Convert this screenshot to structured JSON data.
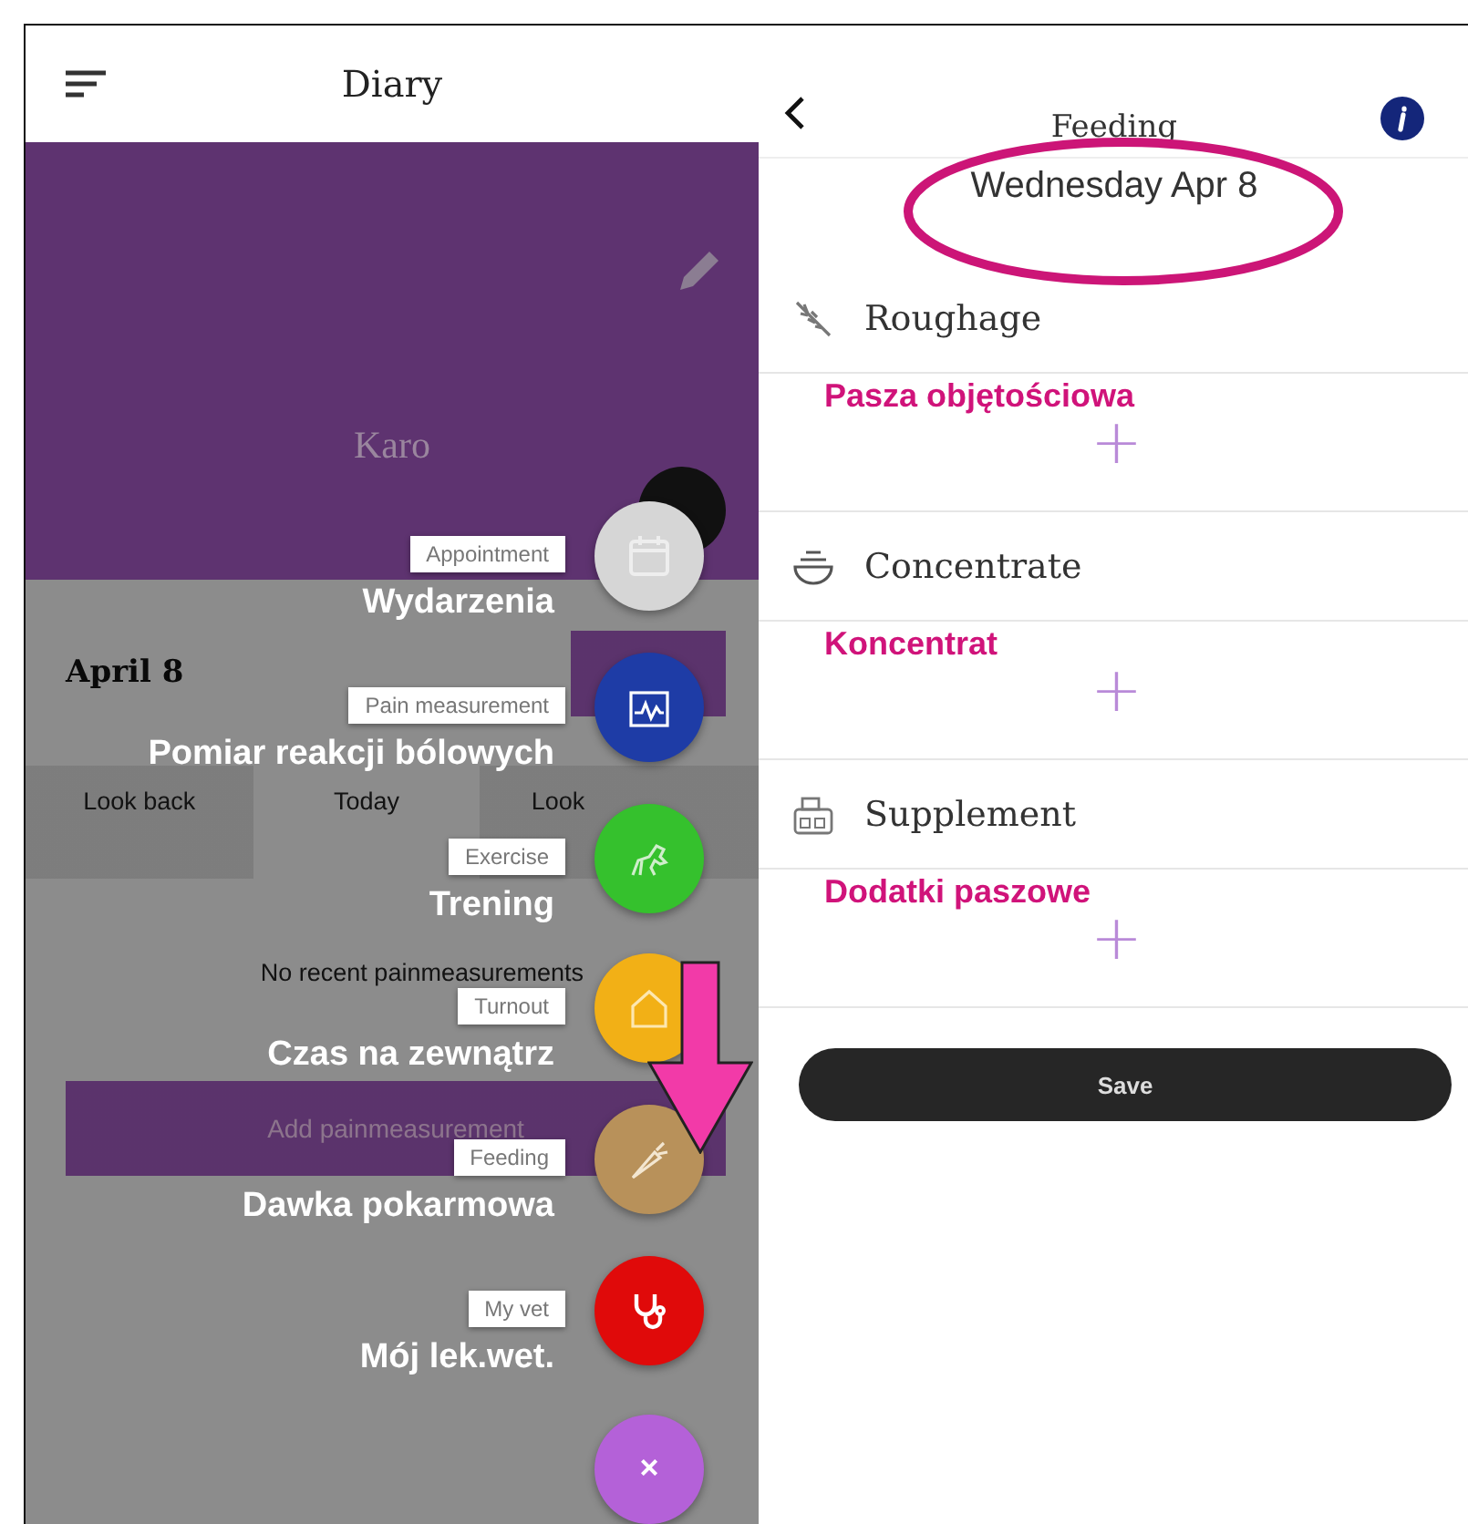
{
  "left_screen": {
    "header": {
      "title": "Diary"
    },
    "banner": {
      "name": "Karo"
    },
    "date": "April 8",
    "tabs": [
      {
        "label": "Look back",
        "selected": false
      },
      {
        "label": "Today",
        "selected": true
      },
      {
        "label": "Look",
        "selected": false
      }
    ],
    "empty_message": "No recent painmeasurements",
    "add_button": "Add painmeasurement",
    "fab_menu": {
      "items": [
        {
          "kind": "calendar",
          "label": "Appointment",
          "annotation": "Wydarzenia",
          "color": "#d6d6d6"
        },
        {
          "kind": "chart",
          "label": "Pain measurement",
          "annotation": "Pomiar reakcji bólowych",
          "color": "#1e3ca6"
        },
        {
          "kind": "horse",
          "label": "Exercise",
          "annotation": "Trening",
          "color": "#35c12d"
        },
        {
          "kind": "house",
          "label": "Turnout",
          "annotation": "Czas na zewnątrz",
          "color": "#f2b016"
        },
        {
          "kind": "carrot",
          "label": "Feeding",
          "annotation": "Dawka pokarmowa",
          "color": "#b8915a"
        },
        {
          "kind": "stethoscope",
          "label": "My vet",
          "annotation": "Mój lek.wet.",
          "color": "#e00a0a"
        }
      ],
      "close": "×"
    }
  },
  "right_screen": {
    "header": {
      "title": "Feeding",
      "date": "Wednesday Apr 8"
    },
    "sections": [
      {
        "kind": "wheat",
        "name": "Roughage",
        "annotation": "Pasza objętościowa",
        "plus": "+"
      },
      {
        "kind": "bowl",
        "name": "Concentrate",
        "annotation": "Koncentrat",
        "plus": "+"
      },
      {
        "kind": "jar",
        "name": "Supplement",
        "annotation": "Dodatki paszowe",
        "plus": "+"
      }
    ],
    "save_button": "Save"
  }
}
